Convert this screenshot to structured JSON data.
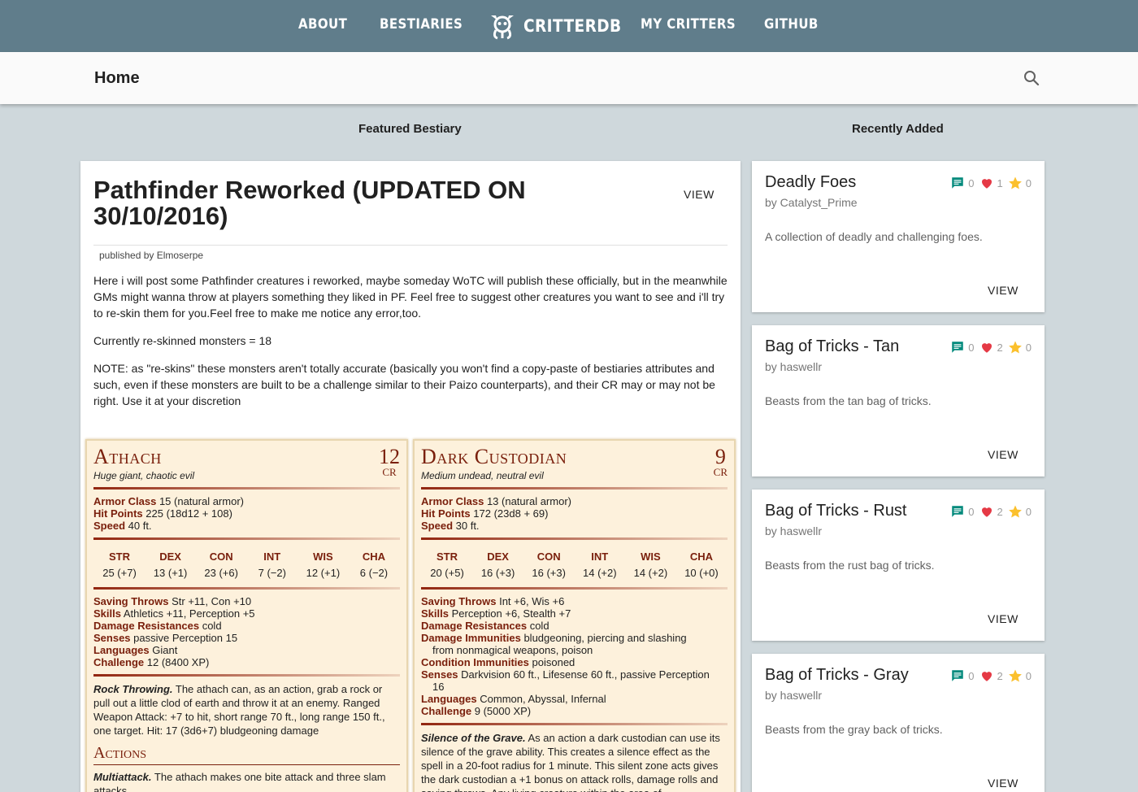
{
  "nav": {
    "about": "ABOUT",
    "bestiaries": "BESTIARIES",
    "brand": "CRITTERDB",
    "my_critters": "MY CRITTERS",
    "github": "GITHUB"
  },
  "subbar": {
    "title": "Home",
    "search_icon": "search-icon"
  },
  "sections": {
    "featured": "Featured Bestiary",
    "recent": "Recently Added"
  },
  "featured": {
    "title": "Pathfinder Reworked (UPDATED ON 30/10/2016)",
    "view_label": "VIEW",
    "published_by": "published by Elmoserpe",
    "desc": [
      "Here i will post some Pathfinder creatures i reworked, maybe someday WoTC will publish these officially, but in the meanwhile GMs might wanna throw at players something they liked in PF. Feel free to suggest other creatures you want to see and i'll try to re-skin them for you.Feel free to make me notice any error,too.",
      "Currently re-skinned monsters = 18",
      "NOTE: as \"re-skins\" these monsters aren't totally accurate (basically you won't find a copy-paste of bestiaries attributes and such, even if these monsters are built to be a challenge similar to their Paizo counterparts), and their CR may or may not be right. Use it at your discretion"
    ]
  },
  "creatures": [
    {
      "name": "Athach",
      "cr": "12",
      "cr_label": "CR",
      "type": "Huge giant, chaotic evil",
      "ac_label": "Armor Class",
      "ac": "15 (natural armor)",
      "hp_label": "Hit Points",
      "hp": "225 (18d12 + 108)",
      "speed_label": "Speed",
      "speed": "40 ft.",
      "abilities": [
        {
          "h": "STR",
          "v": "25 (+7)"
        },
        {
          "h": "DEX",
          "v": "13 (+1)"
        },
        {
          "h": "CON",
          "v": "23 (+6)"
        },
        {
          "h": "INT",
          "v": "7 (−2)"
        },
        {
          "h": "WIS",
          "v": "12 (+1)"
        },
        {
          "h": "CHA",
          "v": "6 (−2)"
        }
      ],
      "props": [
        {
          "k": "Saving Throws",
          "v": "Str +11, Con +10"
        },
        {
          "k": "Skills",
          "v": "Athletics +11, Perception +5"
        },
        {
          "k": "Damage Resistances",
          "v": "cold"
        },
        {
          "k": "Senses",
          "v": "passive Perception 15"
        },
        {
          "k": "Languages",
          "v": "Giant"
        },
        {
          "k": "Challenge",
          "v": "12 (8400 XP)"
        }
      ],
      "trait_name": "Rock Throwing.",
      "trait_text": "The athach can, as an action, grab a rock or pull out a little clod of earth and throw it at an enemy. Ranged Weapon Attack: +7 to hit, short range 70 ft., long range 150 ft., one target. Hit: 17 (3d6+7) bludgeoning damage",
      "actions_label": "Actions",
      "action_name": "Multiattack.",
      "action_text": "The athach makes one bite attack and three slam attacks."
    },
    {
      "name": "Dark Custodian",
      "cr": "9",
      "cr_label": "CR",
      "type": "Medium undead, neutral evil",
      "ac_label": "Armor Class",
      "ac": "13 (natural armor)",
      "hp_label": "Hit Points",
      "hp": "172 (23d8 + 69)",
      "speed_label": "Speed",
      "speed": "30 ft.",
      "abilities": [
        {
          "h": "STR",
          "v": "20 (+5)"
        },
        {
          "h": "DEX",
          "v": "16 (+3)"
        },
        {
          "h": "CON",
          "v": "16 (+3)"
        },
        {
          "h": "INT",
          "v": "14 (+2)"
        },
        {
          "h": "WIS",
          "v": "14 (+2)"
        },
        {
          "h": "CHA",
          "v": "10 (+0)"
        }
      ],
      "props": [
        {
          "k": "Saving Throws",
          "v": "Int +6, Wis +6"
        },
        {
          "k": "Skills",
          "v": "Perception +6, Stealth +7"
        },
        {
          "k": "Damage Resistances",
          "v": "cold"
        },
        {
          "k": "Damage Immunities",
          "v": "bludgeoning, piercing and slashing",
          "cont": "from nonmagical weapons, poison"
        },
        {
          "k": "Condition Immunities",
          "v": "poisoned"
        },
        {
          "k": "Senses",
          "v": "Darkvision 60 ft., Lifesense 60 ft., passive Perception",
          "cont": "16"
        },
        {
          "k": "Languages",
          "v": "Common, Abyssal, Infernal"
        },
        {
          "k": "Challenge",
          "v": "9 (5000 XP)"
        }
      ],
      "trait_name": "Silence of the Grave.",
      "trait_text": "As an action a dark custodian can use its silence of the grave ability. This creates a silence effect as the spell in a 20-foot radius for 1 minute. This silent zone acts gives the dark custodian a +1 bonus on attack rolls, damage rolls and saving throws. Any living creature within the area of"
    }
  ],
  "recent": [
    {
      "title": "Deadly Foes",
      "by": "by Catalyst_Prime",
      "desc": "A collection of deadly and challenging foes.",
      "comments": "0",
      "likes": "1",
      "favorites": "0",
      "view": "VIEW"
    },
    {
      "title": "Bag of Tricks - Tan",
      "by": "by haswellr",
      "desc": "Beasts from the tan bag of tricks.",
      "comments": "0",
      "likes": "2",
      "favorites": "0",
      "view": "VIEW"
    },
    {
      "title": "Bag of Tricks - Rust",
      "by": "by haswellr",
      "desc": "Beasts from the rust bag of tricks.",
      "comments": "0",
      "likes": "2",
      "favorites": "0",
      "view": "VIEW"
    },
    {
      "title": "Bag of Tricks - Gray",
      "by": "by haswellr",
      "desc": "Beasts from the gray back of tricks.",
      "comments": "0",
      "likes": "2",
      "favorites": "0",
      "view": "VIEW"
    }
  ],
  "colors": {
    "nav": "#607d8b",
    "background": "#cfd8dc",
    "statblock": "#fdf1dc",
    "accent": "#7a200d",
    "comment": "#00897b",
    "heart": "#e53945",
    "star": "#fbc02d"
  }
}
